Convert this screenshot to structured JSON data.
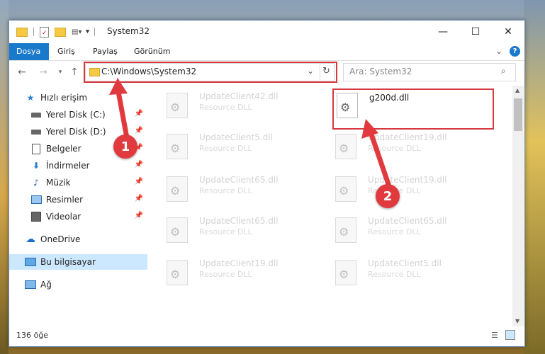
{
  "window": {
    "title": "System32",
    "minimize": "—",
    "maximize": "☐",
    "close": "✕"
  },
  "ribbon": {
    "tabs": [
      "Dosya",
      "Giriş",
      "Paylaş",
      "Görünüm"
    ],
    "collapse": "⌄",
    "help": "?"
  },
  "address": {
    "path": "C:\\Windows\\System32",
    "search_placeholder": "Ara: System32"
  },
  "sidebar": {
    "items": [
      {
        "label": "Hızlı erişim",
        "icon": "star-icon"
      },
      {
        "label": "Yerel Disk (C:)",
        "icon": "disk-icon",
        "pinned": true
      },
      {
        "label": "Yerel Disk (D:)",
        "icon": "disk-icon",
        "pinned": true
      },
      {
        "label": "Belgeler",
        "icon": "document-icon",
        "pinned": true
      },
      {
        "label": "İndirmeler",
        "icon": "download-icon",
        "pinned": true
      },
      {
        "label": "Müzik",
        "icon": "music-icon",
        "pinned": true
      },
      {
        "label": "Resimler",
        "icon": "picture-icon",
        "pinned": true
      },
      {
        "label": "Videolar",
        "icon": "video-icon",
        "pinned": true
      },
      {
        "label": "OneDrive",
        "icon": "cloud-icon"
      },
      {
        "label": "Bu bilgisayar",
        "icon": "computer-icon"
      },
      {
        "label": "Ağ",
        "icon": "network-icon"
      }
    ]
  },
  "files": [
    {
      "name": "UpdateClient42.dll",
      "type": "Resource DLL"
    },
    {
      "name": "g200d.dll",
      "type": ""
    },
    {
      "name": "UpdateClient5.dll",
      "type": "Resource DLL"
    },
    {
      "name": "UpdateClient19.dll",
      "type": "Resource DLL"
    },
    {
      "name": "UpdateClient65.dll",
      "type": "Resource DLL"
    },
    {
      "name": "UpdateClient19.dll",
      "type": "Resource DLL"
    },
    {
      "name": "UpdateClient65.dll",
      "type": "Resource DLL"
    },
    {
      "name": "UpdateClient65.dll",
      "type": "Resource DLL"
    },
    {
      "name": "UpdateClient19.dll",
      "type": "Resource DLL"
    },
    {
      "name": "UpdateClient5.dll",
      "type": "Resource DLL"
    }
  ],
  "status": {
    "count": "136 öğe"
  },
  "annotations": {
    "step1": "1",
    "step2": "2"
  },
  "colors": {
    "accent": "#1979ca",
    "highlight": "#d6393e",
    "selected": "#cce8ff"
  }
}
